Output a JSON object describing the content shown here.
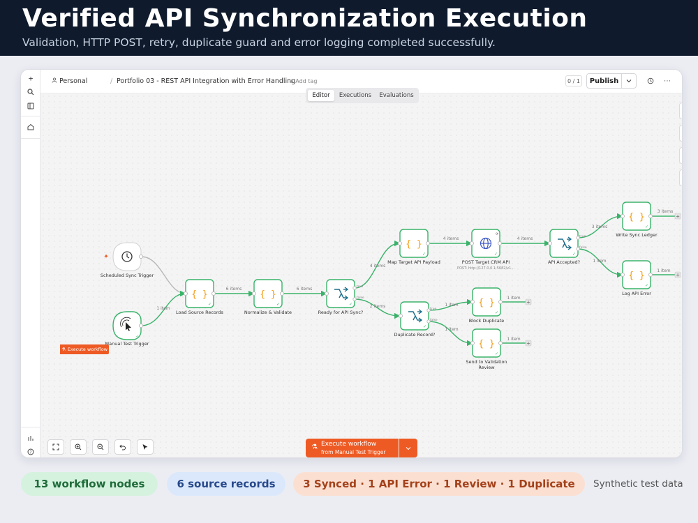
{
  "hero": {
    "title": "Verified API Synchronization Execution",
    "subtitle": "Validation, HTTP POST, retry, duplicate guard and error logging completed successfully."
  },
  "topbar": {
    "owner": "Personal",
    "separator": "/",
    "workflow_name": "Portfolio 03 - REST API Integration with Error Handling",
    "add_tag": "+ Add tag",
    "counter": "0 / 1",
    "publish_label": "Publish"
  },
  "tabs": [
    {
      "label": "Editor",
      "active": true
    },
    {
      "label": "Executions",
      "active": false
    },
    {
      "label": "Evaluations",
      "active": false
    }
  ],
  "canvas": {
    "execute_tag": "Execute workflow",
    "execute_button": {
      "line1": "Execute workflow",
      "line2": "from Manual Test Trigger"
    },
    "nodes": [
      {
        "id": "sched",
        "label": "Scheduled Sync Trigger",
        "kind": "clock"
      },
      {
        "id": "manual",
        "label": "Manual Test Trigger",
        "kind": "cursor"
      },
      {
        "id": "load",
        "label": "Load Source Records",
        "kind": "code"
      },
      {
        "id": "norm",
        "label": "Normalize & Validate",
        "kind": "code"
      },
      {
        "id": "ready",
        "label": "Ready for API Sync?",
        "kind": "if"
      },
      {
        "id": "map",
        "label": "Map Target API Payload",
        "kind": "code"
      },
      {
        "id": "post",
        "label": "POST Target CRM API",
        "sublabel": "POST: http://127.0.0.1:5682/v1...",
        "kind": "globe"
      },
      {
        "id": "acc",
        "label": "API Accepted?",
        "kind": "if"
      },
      {
        "id": "ledger",
        "label": "Write Sync Ledger",
        "kind": "code"
      },
      {
        "id": "logerr",
        "label": "Log API Error",
        "kind": "code"
      },
      {
        "id": "dup",
        "label": "Duplicate Record?",
        "kind": "if"
      },
      {
        "id": "block",
        "label": "Block Duplicate",
        "kind": "code"
      },
      {
        "id": "review",
        "label": "Send to Validation Review",
        "kind": "code"
      }
    ],
    "edge_labels": {
      "manual_load": "1 item",
      "load_norm": "6 items",
      "norm_ready": "6 items",
      "ready_map": "4 items",
      "ready_dup": "2 items",
      "map_post": "4 items",
      "post_acc": "4 items",
      "acc_ledger": "3 items",
      "acc_logerr": "1 item",
      "dup_block": "1 item",
      "dup_review": "1 item",
      "ledger_out": "3 items",
      "logerr_out": "1 item",
      "block_out": "1 item",
      "review_out": "1 item"
    },
    "branch_labels": {
      "true": "true",
      "false": "false"
    }
  },
  "footer": {
    "nodes_pill": "13 workflow nodes",
    "records_pill": "6 source records",
    "results_pill": "3 Synced · 1 API Error · 1 Review · 1 Duplicate",
    "note": "Synthetic test data"
  },
  "colors": {
    "accent": "#ee5a24",
    "success": "#2fae5b",
    "node_border": "#39b36a",
    "code_brace": "#f39c12",
    "hero_bg": "#0f1b2d"
  }
}
